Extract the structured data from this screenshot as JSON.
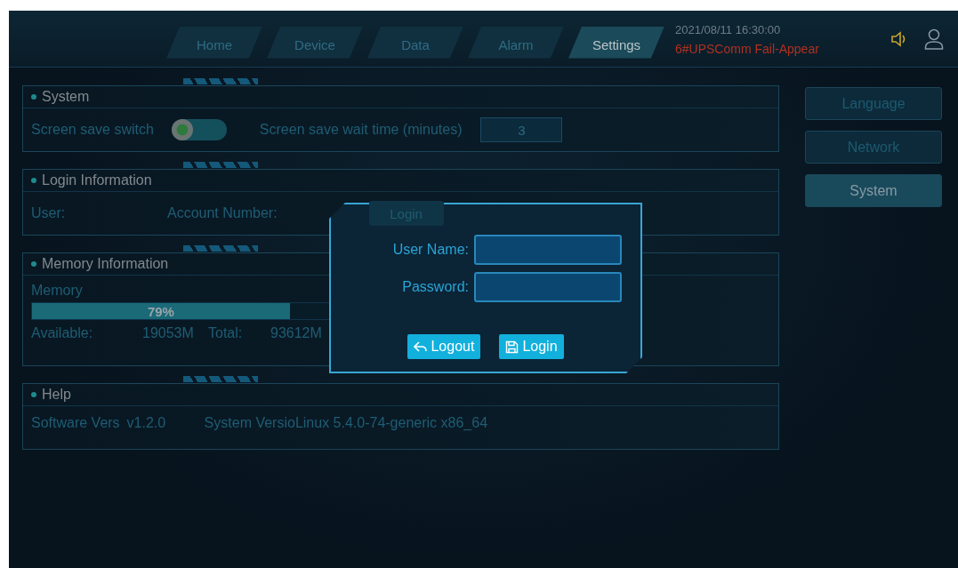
{
  "nav": {
    "tabs": [
      {
        "label": "Home",
        "selected": false
      },
      {
        "label": "Device",
        "selected": false
      },
      {
        "label": "Data",
        "selected": false
      },
      {
        "label": "Alarm",
        "selected": false
      },
      {
        "label": "Settings",
        "selected": true
      }
    ],
    "datetime": "2021/08/11  16:30:00",
    "alarm": "6#UPSComm Fail-Appear"
  },
  "system": {
    "title": "System",
    "switch_label": "Screen save switch",
    "switch_on": false,
    "wait_label": "Screen save wait time (minutes)",
    "wait_value": "3"
  },
  "login_info": {
    "title": "Login Information",
    "user_label": "User:",
    "account_label": "Account Number:",
    "button": "Login"
  },
  "memory": {
    "title": "Memory Information",
    "label": "Memory",
    "level": 0.79,
    "percent": "79%",
    "available_label": "Available:",
    "available": "19053M",
    "total_label": "Total:",
    "total": "93612M"
  },
  "help": {
    "title": "Help",
    "software_label": "Software Vers",
    "software": "v1.2.0",
    "system_label": "System Versio",
    "system": "Linux 5.4.0-74-generic x86_64"
  },
  "sidebar": {
    "items": [
      {
        "label": "Language",
        "selected": false
      },
      {
        "label": "Network",
        "selected": false
      },
      {
        "label": "System",
        "selected": true
      }
    ]
  },
  "dialog": {
    "username_label": "User Name:",
    "password_label": "Password:",
    "logout": "Logout",
    "login": "Login"
  }
}
